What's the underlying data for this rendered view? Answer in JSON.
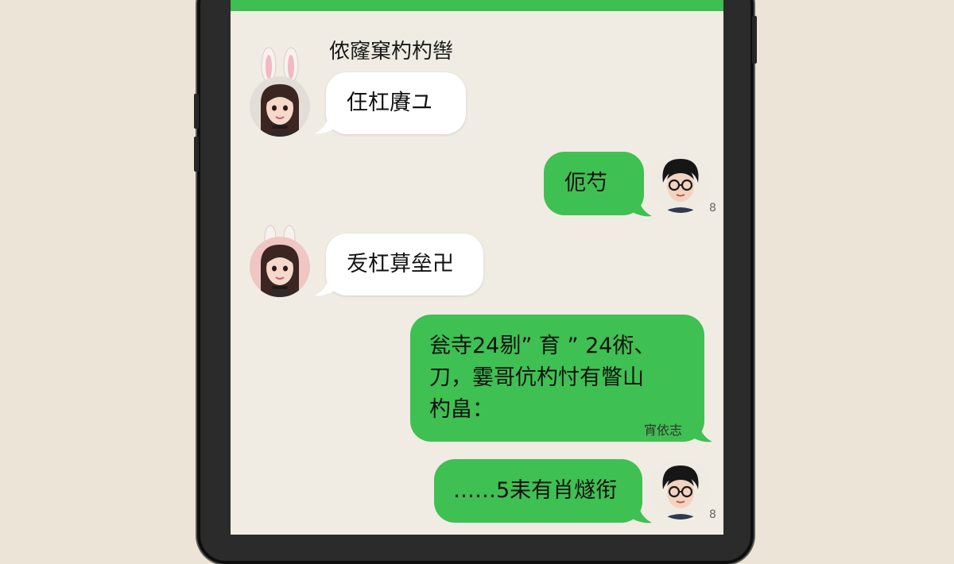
{
  "chat": {
    "contact_name": "侬窿窠杓杓辔"
  },
  "messages": [
    {
      "side": "in",
      "text": "仼杠賡ユ"
    },
    {
      "side": "out",
      "text": "伌芍"
    },
    {
      "side": "in",
      "text": "叐杠萛垒卍"
    },
    {
      "side": "out",
      "text": "瓮寺24剔” 育 ” 24術、\n刀，霎哥伉杓忖有瞥山\n杓畠：",
      "note": "宵依志"
    },
    {
      "side": "out",
      "text": "……5耒有肖燧衔"
    }
  ],
  "marks": {
    "m1": "8",
    "m2": "8"
  },
  "colors": {
    "accent_green": "#3fc052",
    "screen_bg": "#f1ece3",
    "page_bg": "#ece4d6"
  },
  "icons": {
    "girl_avatar": "girl-avatar-icon",
    "boy_avatar": "boy-avatar-icon"
  }
}
